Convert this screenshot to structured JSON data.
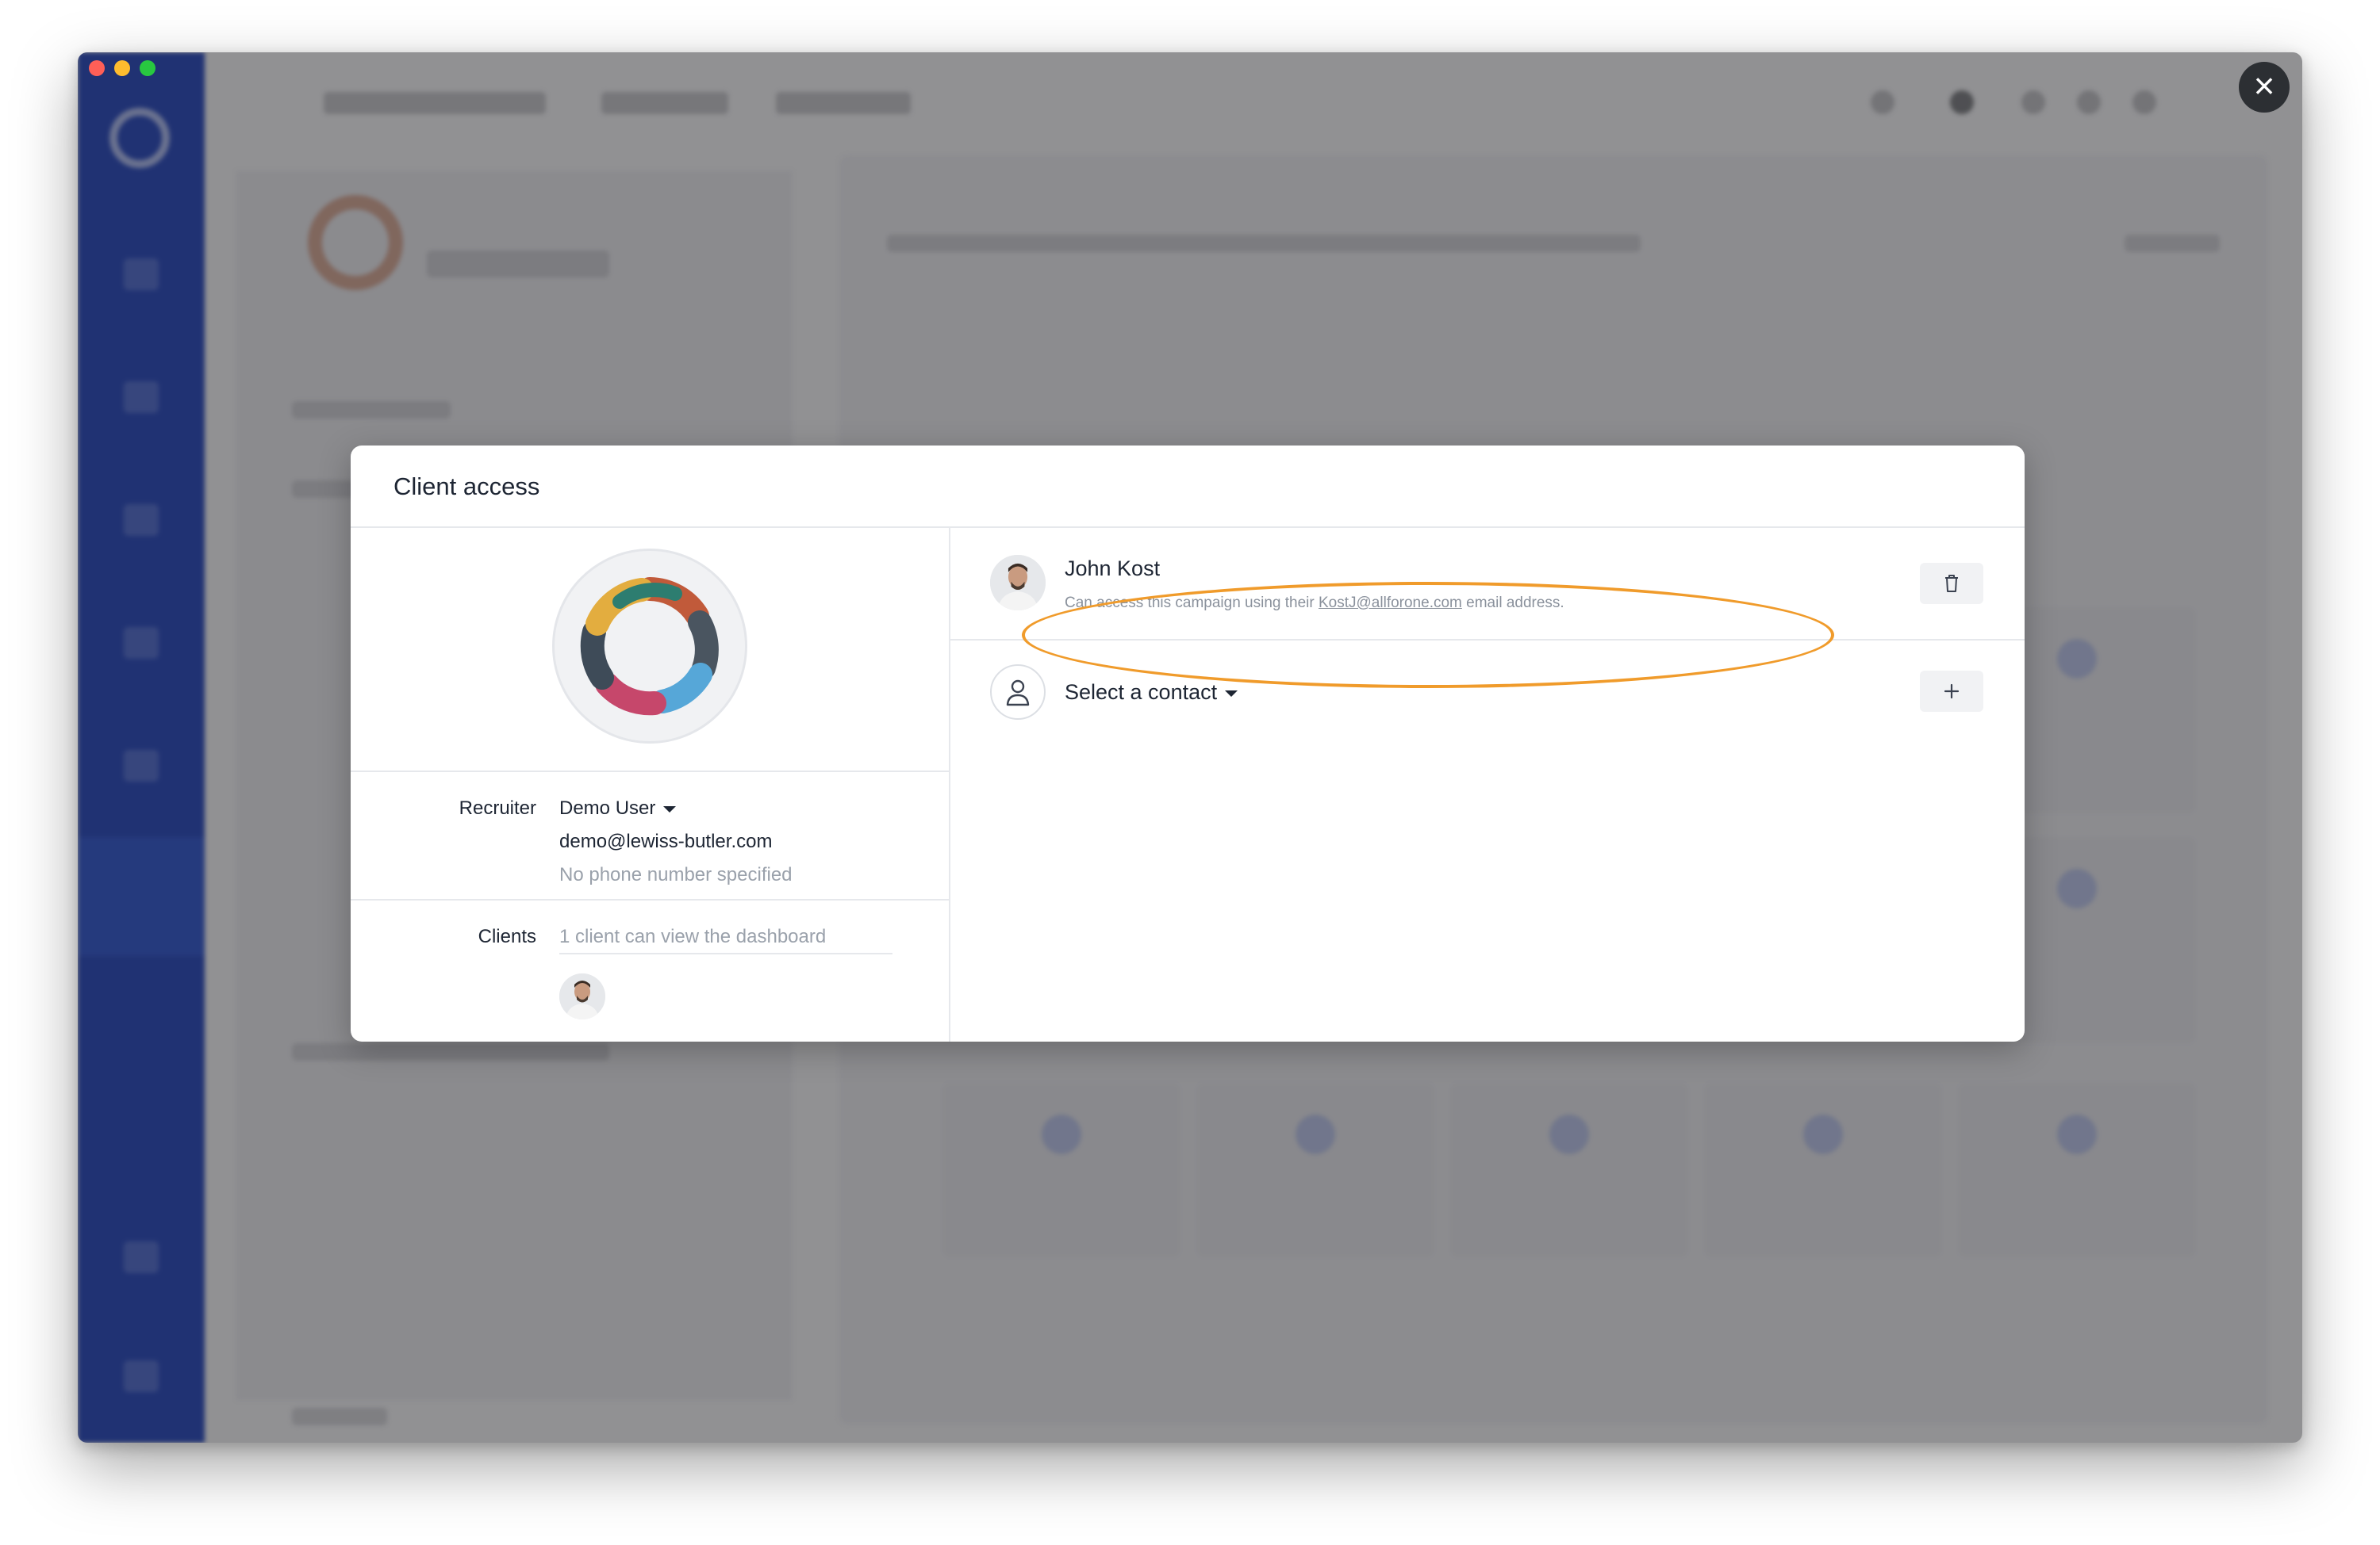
{
  "modal": {
    "title": "Client access",
    "recruiter": {
      "label": "Recruiter",
      "name": "Demo User",
      "email": "demo@lewiss-butler.com",
      "phone": "No phone number specified"
    },
    "clients": {
      "label": "Clients",
      "summary": "1 client can view the dashboard"
    },
    "contacts": [
      {
        "name": "John Kost",
        "desc_prefix": "Can access this campaign using their ",
        "email": "KostJ@allforone.com",
        "desc_suffix": " email address."
      }
    ],
    "select_contact": "Select a contact"
  },
  "icons": {
    "close": "close-icon",
    "delete": "trash-icon",
    "add": "plus-icon",
    "person": "person-icon"
  },
  "colors": {
    "highlight": "#f09b2b",
    "sidebar": "#1b3aa8",
    "modal_text": "#1d2533"
  }
}
